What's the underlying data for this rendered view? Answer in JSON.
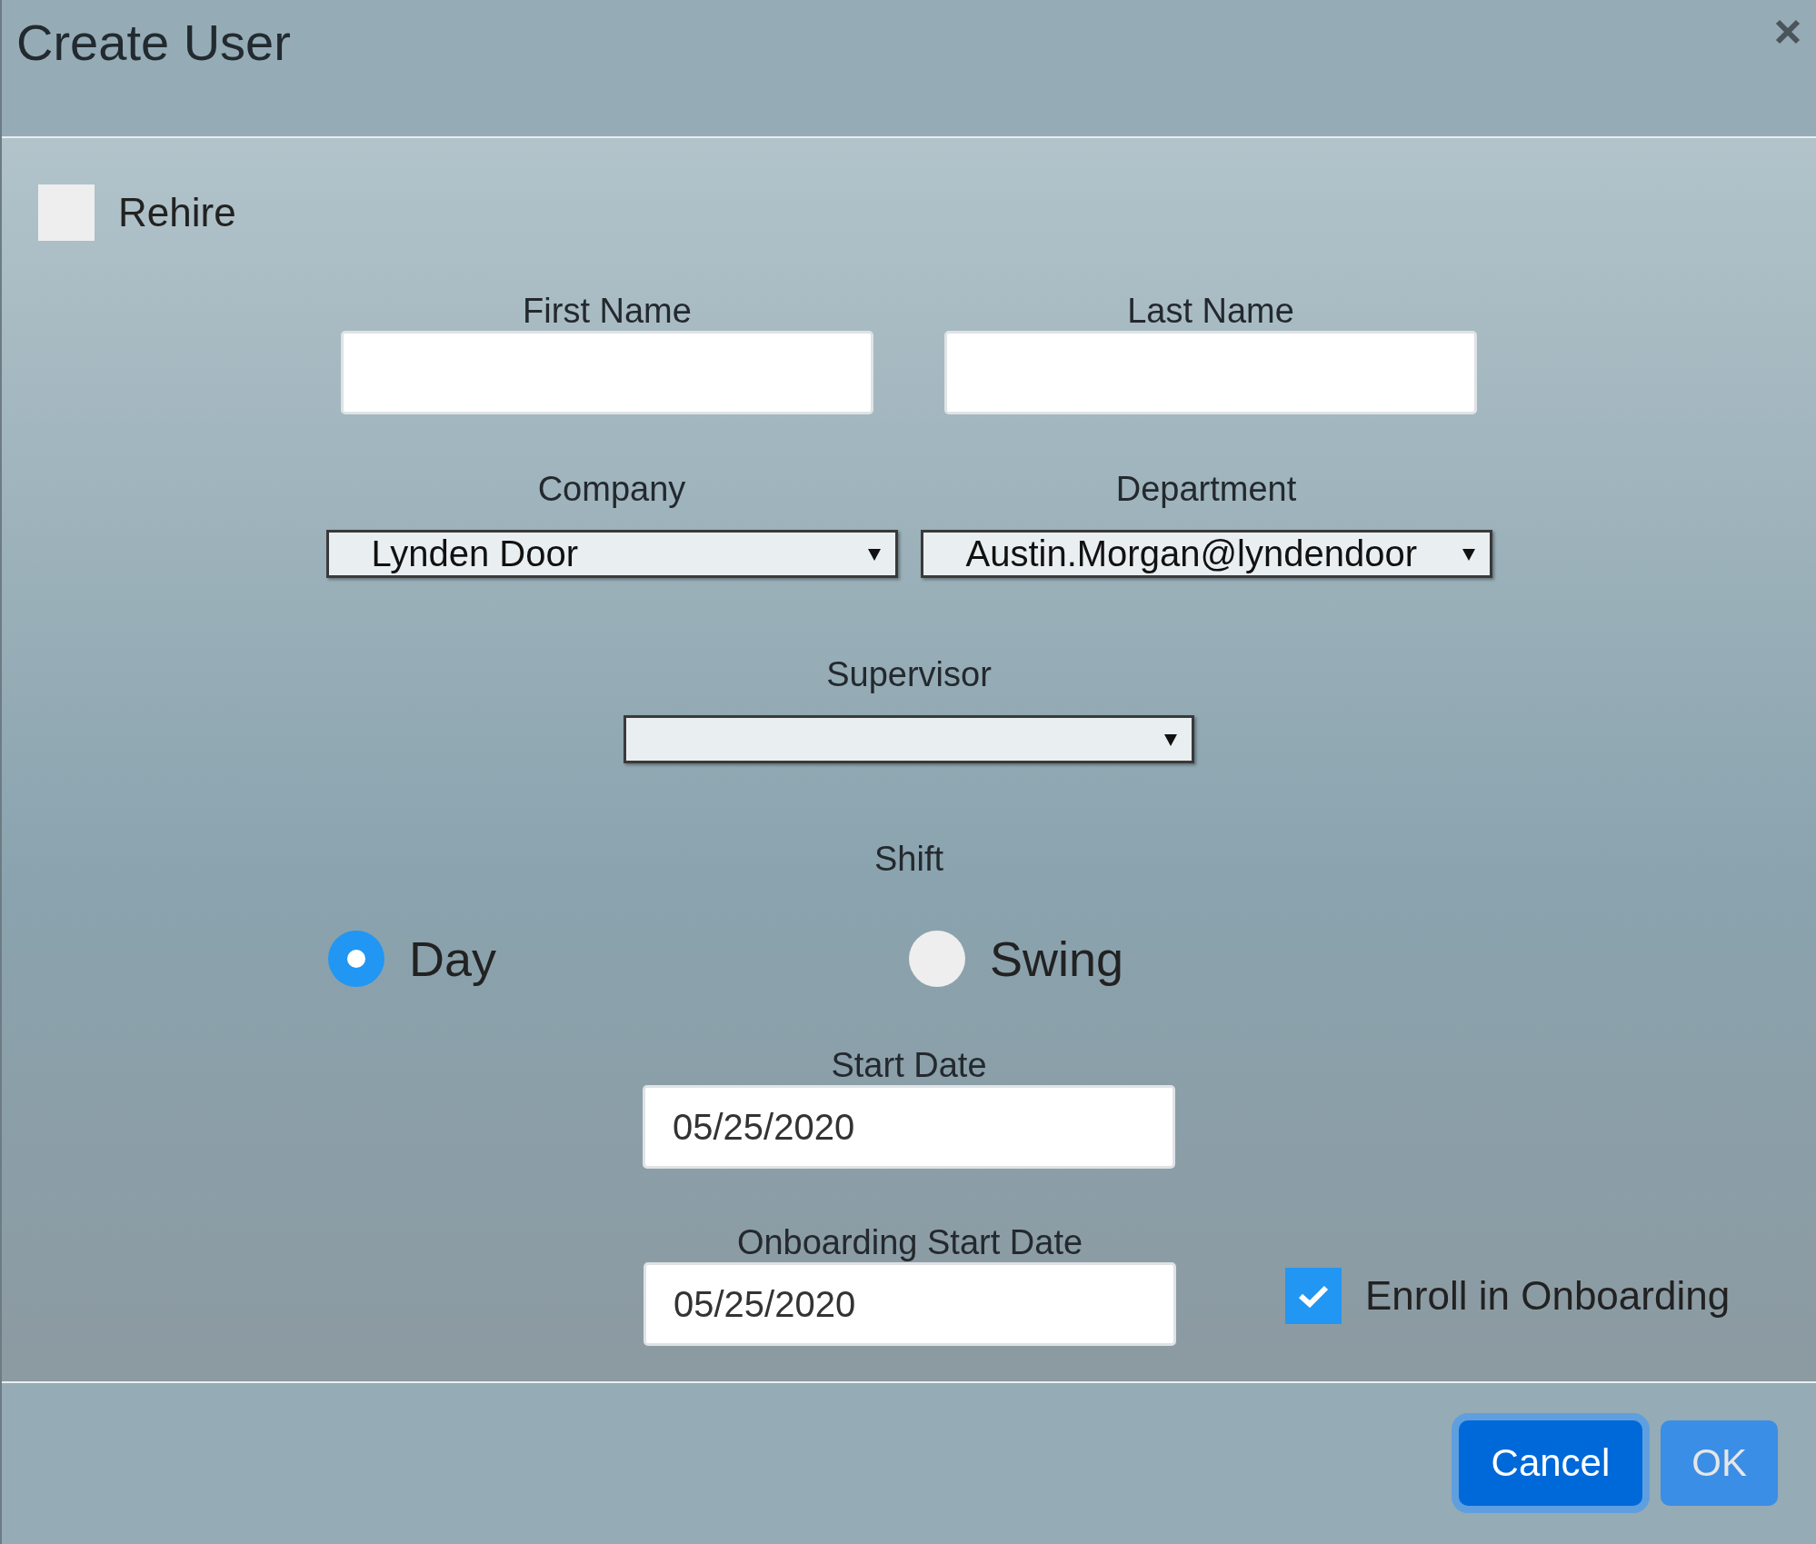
{
  "dialog": {
    "title": "Create User"
  },
  "rehire": {
    "label": "Rehire",
    "checked": false
  },
  "name_fields": [
    {
      "label": "First Name"
    },
    {
      "label": "Last Name"
    }
  ],
  "selects": [
    {
      "label": "Company",
      "value": "Lynden Door"
    },
    {
      "label": "Department",
      "value": "Austin.Morgan@lyndendoor"
    }
  ],
  "supervisor": {
    "label": "Supervisor"
  },
  "shift": {
    "label": "Shift",
    "options": [
      {
        "label": "Day",
        "selected": true
      },
      {
        "label": "Swing",
        "selected": false
      }
    ]
  },
  "start_date": {
    "label": "Start Date",
    "value": "05/25/2020"
  },
  "onboarding_start_date": {
    "label": "Onboarding Start Date",
    "value": "05/25/2020"
  },
  "enroll": {
    "label": "Enroll in Onboarding",
    "checked": true
  },
  "buttons": [
    {
      "label": "Cancel",
      "focused": true
    },
    {
      "label": "OK",
      "focused": false
    }
  ]
}
